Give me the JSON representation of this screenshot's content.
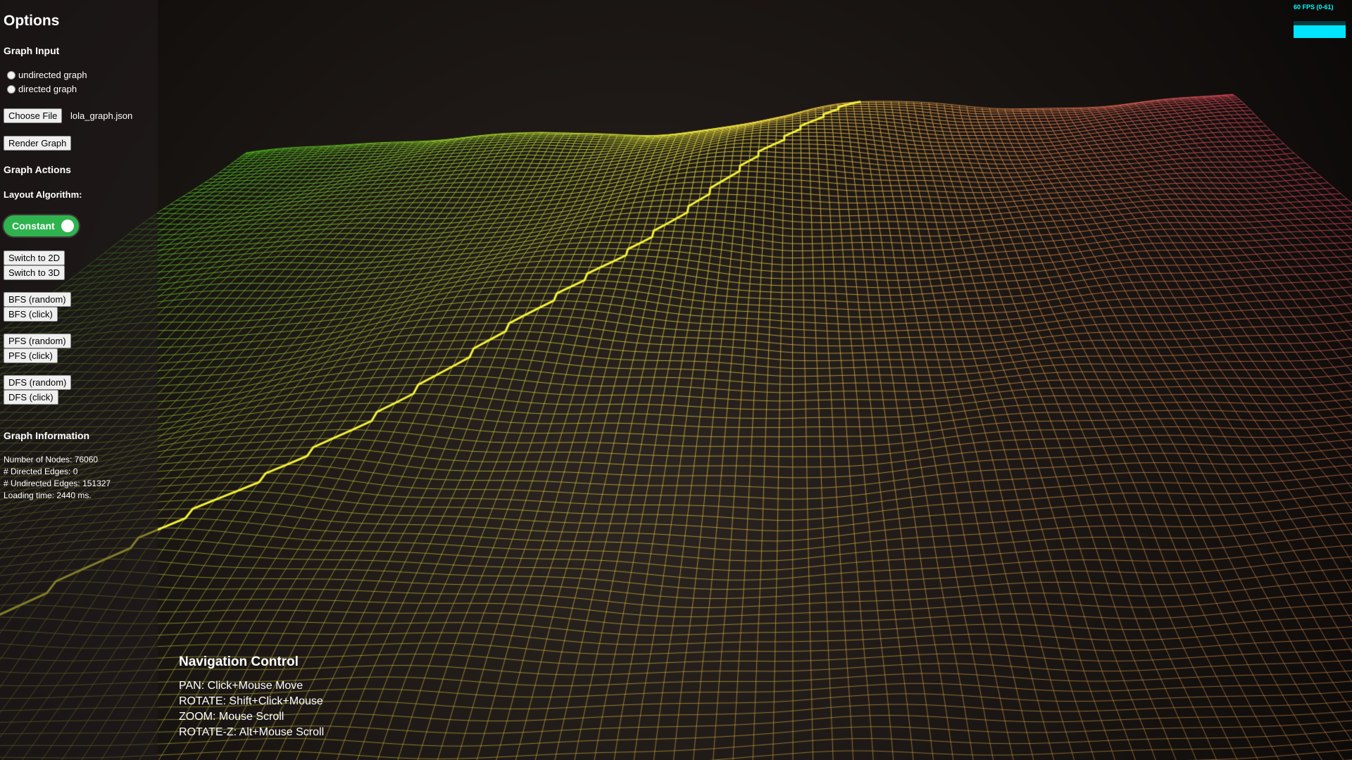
{
  "options": {
    "title": "Options",
    "graph_input": {
      "heading": "Graph Input",
      "radio_undirected": "undirected graph",
      "radio_directed": "directed graph",
      "choose_file": "Choose File",
      "file_name": "lola_graph.json",
      "render_button": "Render Graph"
    },
    "graph_actions": {
      "heading": "Graph Actions",
      "layout_label": "Layout Algorithm:",
      "toggle_label": "Constant",
      "buttons": {
        "switch_2d": "Switch to 2D",
        "switch_3d": "Switch to 3D",
        "bfs_random": "BFS (random)",
        "bfs_click": "BFS (click)",
        "pfs_random": "PFS (random)",
        "pfs_click": "PFS (click)",
        "dfs_random": "DFS (random)",
        "dfs_click": "DFS (click)"
      }
    },
    "graph_info": {
      "heading": "Graph Information",
      "nodes": "Number of Nodes: 76060",
      "directed_edges": "# Directed Edges: 0",
      "undirected_edges": "# Undirected Edges: 151327",
      "loading": "Loading time: 2440 ms."
    }
  },
  "navigation": {
    "title": "Navigation Control",
    "pan": "PAN: Click+Mouse Move",
    "rotate": "ROTATE: Shift+Click+Mouse",
    "zoom": "ZOOM: Mouse Scroll",
    "rotate_z": "ROTATE-Z: Alt+Mouse Scroll"
  },
  "fps": {
    "label": "60 FPS (0-61)",
    "value": 60,
    "min": 0,
    "max": 61
  },
  "colors": {
    "toggle_on": "#2fb34e",
    "fps": "#00e5ff",
    "mesh_left": "#4fc21e",
    "mesh_ridge": "#f4f03a",
    "mesh_right": "#e0455e",
    "mesh_bottom": "#e8a94a"
  }
}
